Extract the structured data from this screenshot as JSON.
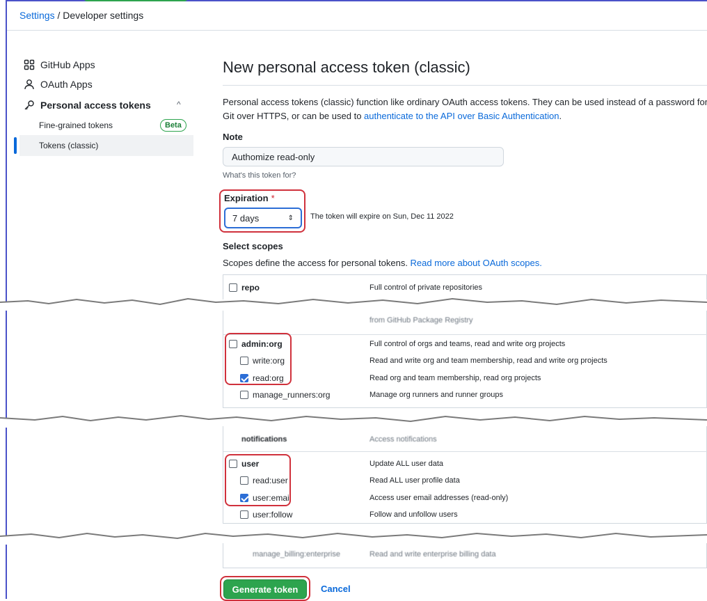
{
  "breadcrumb": {
    "settings": "Settings",
    "separator": " / ",
    "current": "Developer settings"
  },
  "sidebar": {
    "items": [
      {
        "label": "GitHub Apps",
        "icon": "apps-icon"
      },
      {
        "label": "OAuth Apps",
        "icon": "person-icon"
      },
      {
        "label": "Personal access tokens",
        "icon": "key-icon"
      }
    ],
    "sub_items": [
      {
        "label": "Fine-grained tokens",
        "badge": "Beta"
      },
      {
        "label": "Tokens (classic)",
        "active": true
      }
    ]
  },
  "main": {
    "title": "New personal access token (classic)",
    "description_1": "Personal access tokens (classic) function like ordinary OAuth access tokens. They can be used instead of a password for Git over HTTPS, or can be used to ",
    "description_link": "authenticate to the API over Basic Authentication",
    "description_2": ".",
    "note_label": "Note",
    "note_value": "Authomize read-only",
    "note_help": "What's this token for?",
    "expiration_label": "Expiration",
    "expiration_required": "*",
    "expiration_value": "7 days",
    "expiration_note": "The token will expire on Sun, Dec 11 2022",
    "select_scopes_label": "Select scopes",
    "scopes_desc": "Scopes define the access for personal tokens. ",
    "scopes_link": "Read more about OAuth scopes."
  },
  "scopes": {
    "repo": {
      "name": "repo",
      "desc": "Full control of private repositories",
      "checked": false
    },
    "blur_1": {
      "desc": "from GitHub Package Registry"
    },
    "admin_org": [
      {
        "name": "admin:org",
        "desc": "Full control of orgs and teams, read and write org projects",
        "checked": false
      },
      {
        "name": "write:org",
        "desc": "Read and write org and team membership, read and write org projects",
        "checked": false
      },
      {
        "name": "read:org",
        "desc": "Read org and team membership, read org projects",
        "checked": true
      },
      {
        "name": "manage_runners:org",
        "desc": "Manage org runners and runner groups",
        "checked": false
      }
    ],
    "blur_2": {
      "name": "notifications",
      "desc": "Access notifications"
    },
    "user": [
      {
        "name": "user",
        "desc": "Update ALL user data",
        "checked": false
      },
      {
        "name": "read:user",
        "desc": "Read ALL user profile data",
        "checked": false
      },
      {
        "name": "user:email",
        "desc": "Access user email addresses (read-only)",
        "checked": true
      },
      {
        "name": "user:follow",
        "desc": "Follow and unfollow users",
        "checked": false
      }
    ],
    "blur_3": {
      "name": "manage_billing:enterprise",
      "desc": "Read and write enterprise billing data"
    }
  },
  "actions": {
    "generate": "Generate token",
    "cancel": "Cancel"
  },
  "colors": {
    "accent": "#0969da",
    "primary_button": "#2da44e",
    "highlight": "#d0313c",
    "checkbox": "#2c6ed6"
  }
}
